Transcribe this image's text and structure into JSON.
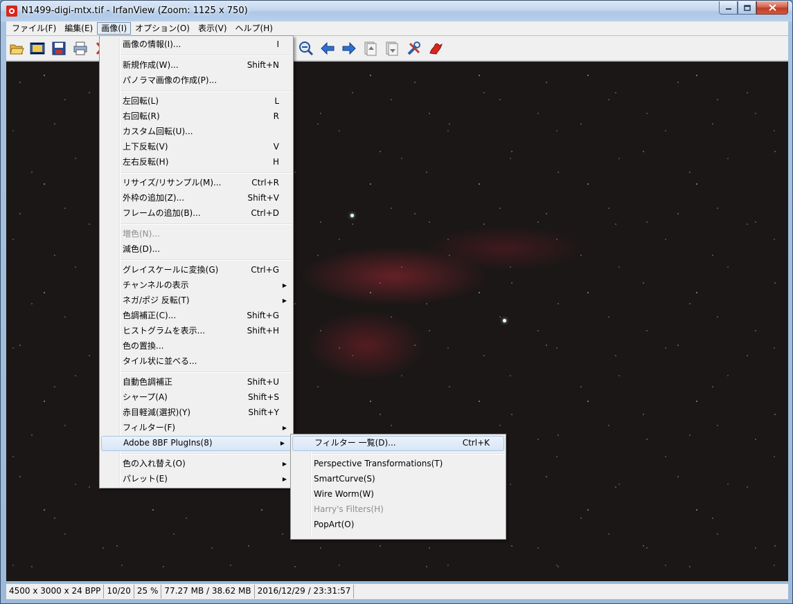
{
  "window": {
    "title": "N1499-digi-mtx.tif - IrfanView (Zoom: 1125 x 750)"
  },
  "menubar": [
    {
      "label": "ファイル(F)"
    },
    {
      "label": "編集(E)"
    },
    {
      "label": "画像(I)"
    },
    {
      "label": "オプション(O)"
    },
    {
      "label": "表示(V)"
    },
    {
      "label": "ヘルプ(H)"
    }
  ],
  "toolbar": {
    "icons": [
      "open-folder-icon",
      "slideshow-icon",
      "save-icon",
      "print-icon",
      "cut-icon",
      "zoom-out-icon",
      "back-arrow-icon",
      "forward-arrow-icon",
      "first-page-icon",
      "last-page-icon",
      "tools-icon",
      "irfanview-logo-icon"
    ]
  },
  "image_menu": {
    "items": [
      {
        "label": "画像の情報(I)...",
        "shortcut": "I"
      },
      {
        "label": "新規作成(W)...",
        "shortcut": "Shift+N"
      },
      {
        "label": "パノラマ画像の作成(P)...",
        "shortcut": ""
      },
      {
        "label": "左回転(L)",
        "shortcut": "L"
      },
      {
        "label": "右回転(R)",
        "shortcut": "R"
      },
      {
        "label": "カスタム回転(U)...",
        "shortcut": ""
      },
      {
        "label": "上下反転(V)",
        "shortcut": "V"
      },
      {
        "label": "左右反転(H)",
        "shortcut": "H"
      },
      {
        "label": "リサイズ/リサンプル(M)...",
        "shortcut": "Ctrl+R"
      },
      {
        "label": "外枠の追加(Z)...",
        "shortcut": "Shift+V"
      },
      {
        "label": "フレームの追加(B)...",
        "shortcut": "Ctrl+D"
      },
      {
        "label": "増色(N)...",
        "shortcut": ""
      },
      {
        "label": "減色(D)...",
        "shortcut": ""
      },
      {
        "label": "グレイスケールに変換(G)",
        "shortcut": "Ctrl+G"
      },
      {
        "label": "チャンネルの表示",
        "shortcut": ""
      },
      {
        "label": "ネガ/ポジ 反転(T)",
        "shortcut": ""
      },
      {
        "label": "色調補正(C)...",
        "shortcut": "Shift+G"
      },
      {
        "label": "ヒストグラムを表示...",
        "shortcut": "Shift+H"
      },
      {
        "label": "色の置換...",
        "shortcut": ""
      },
      {
        "label": "タイル状に並べる...",
        "shortcut": ""
      },
      {
        "label": "自動色調補正",
        "shortcut": "Shift+U"
      },
      {
        "label": "シャープ(A)",
        "shortcut": "Shift+S"
      },
      {
        "label": "赤目軽減(選択)(Y)",
        "shortcut": "Shift+Y"
      },
      {
        "label": "フィルター(F)",
        "shortcut": ""
      },
      {
        "label": "Adobe 8BF PlugIns(8)",
        "shortcut": ""
      },
      {
        "label": "色の入れ替え(O)",
        "shortcut": ""
      },
      {
        "label": "パレット(E)",
        "shortcut": ""
      }
    ]
  },
  "plugin_submenu": {
    "items": [
      {
        "label": "フィルター 一覧(D)...",
        "shortcut": "Ctrl+K"
      },
      {
        "label": "Perspective Transformations(T)"
      },
      {
        "label": "SmartCurve(S)"
      },
      {
        "label": "Wire Worm(W)"
      },
      {
        "label": "Harry's Filters(H)"
      },
      {
        "label": "PopArt(O)"
      }
    ]
  },
  "statusbar": {
    "dimensions": "4500 x 3000 x 24 BPP",
    "index": "10/20",
    "zoom": "25 %",
    "memory": "77.27 MB / 38.62 MB",
    "datetime": "2016/12/29 / 23:31:57"
  },
  "colors": {
    "menu_bg": "#f0f0f0",
    "highlight_border": "#a8c3e2",
    "titlebar": "#c2d6ee",
    "close_button": "#c23c25"
  }
}
